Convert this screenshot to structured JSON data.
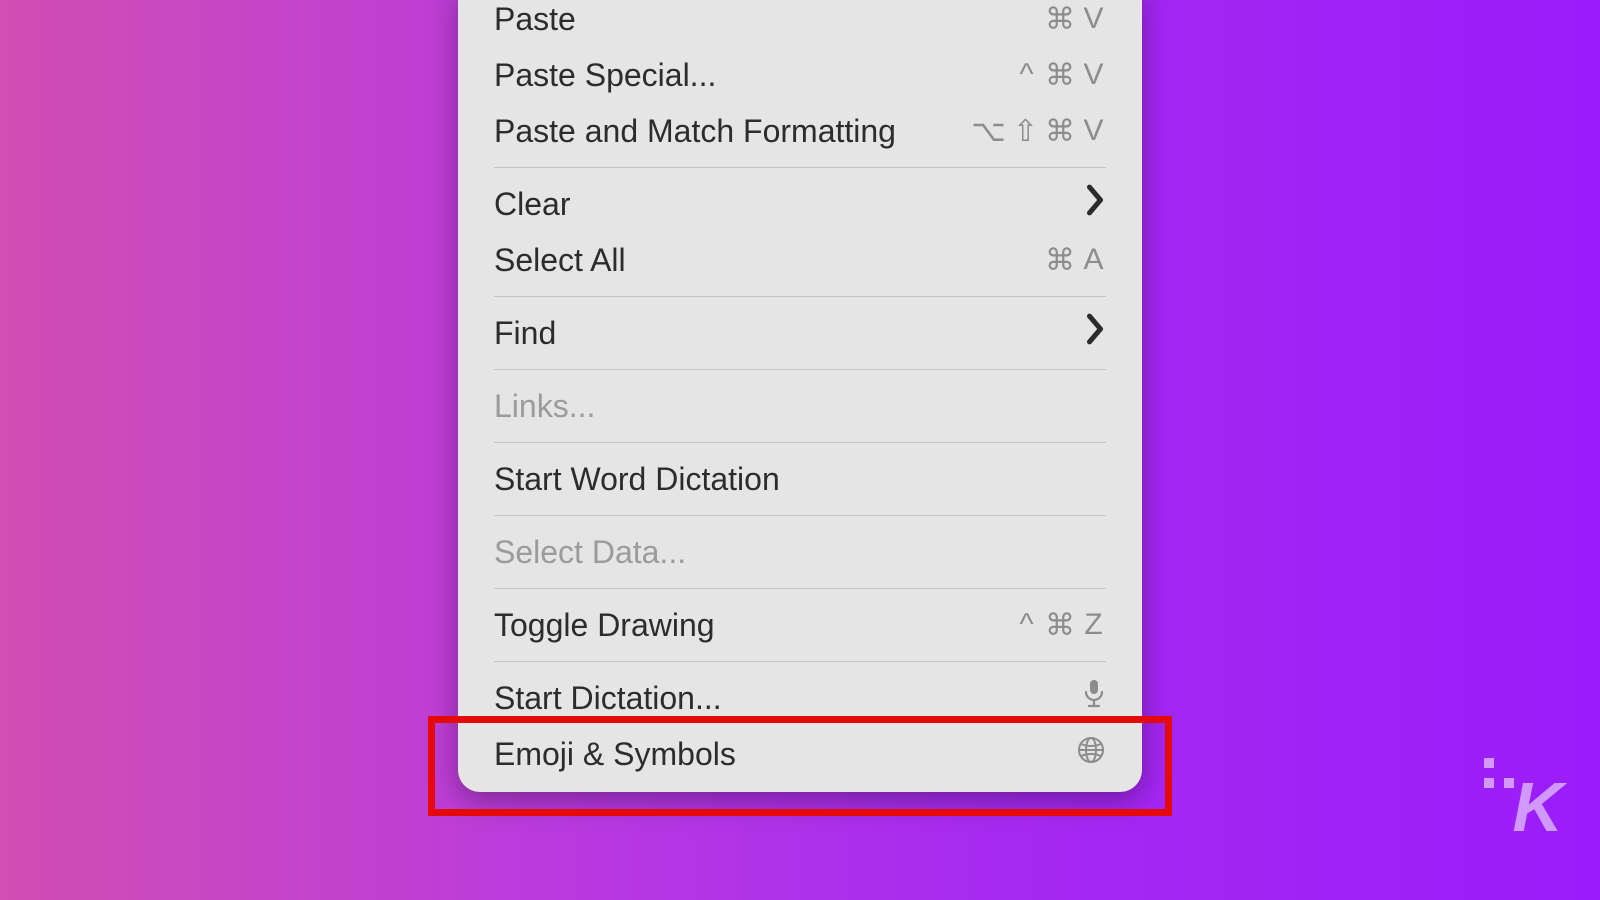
{
  "menu": {
    "groups": [
      [
        {
          "id": "paste",
          "label": "Paste",
          "shortcut": [
            "⌘",
            "V"
          ],
          "disabled": false
        },
        {
          "id": "paste-special",
          "label": "Paste Special...",
          "shortcut": [
            "^",
            "⌘",
            "V"
          ],
          "disabled": false
        },
        {
          "id": "paste-match",
          "label": "Paste and Match Formatting",
          "shortcut": [
            "⌥",
            "⇧",
            "⌘",
            "V"
          ],
          "disabled": false
        }
      ],
      [
        {
          "id": "clear",
          "label": "Clear",
          "submenu": true,
          "disabled": false
        },
        {
          "id": "select-all",
          "label": "Select All",
          "shortcut": [
            "⌘",
            "A"
          ],
          "disabled": false
        }
      ],
      [
        {
          "id": "find",
          "label": "Find",
          "submenu": true,
          "disabled": false
        }
      ],
      [
        {
          "id": "links",
          "label": "Links...",
          "disabled": true
        }
      ],
      [
        {
          "id": "start-word-dictation",
          "label": "Start Word Dictation",
          "disabled": false
        }
      ],
      [
        {
          "id": "select-data",
          "label": "Select Data...",
          "disabled": true
        }
      ],
      [
        {
          "id": "toggle-drawing",
          "label": "Toggle Drawing",
          "shortcut": [
            "^",
            "⌘",
            "Z"
          ],
          "disabled": false
        }
      ],
      [
        {
          "id": "start-dictation",
          "label": "Start Dictation...",
          "icon": "mic",
          "disabled": false
        },
        {
          "id": "emoji-symbols",
          "label": "Emoji & Symbols",
          "icon": "globe",
          "disabled": false
        }
      ]
    ]
  },
  "annotation": {
    "highlighted_item": "emoji-symbols"
  },
  "branding": {
    "logo_letter": "K"
  }
}
